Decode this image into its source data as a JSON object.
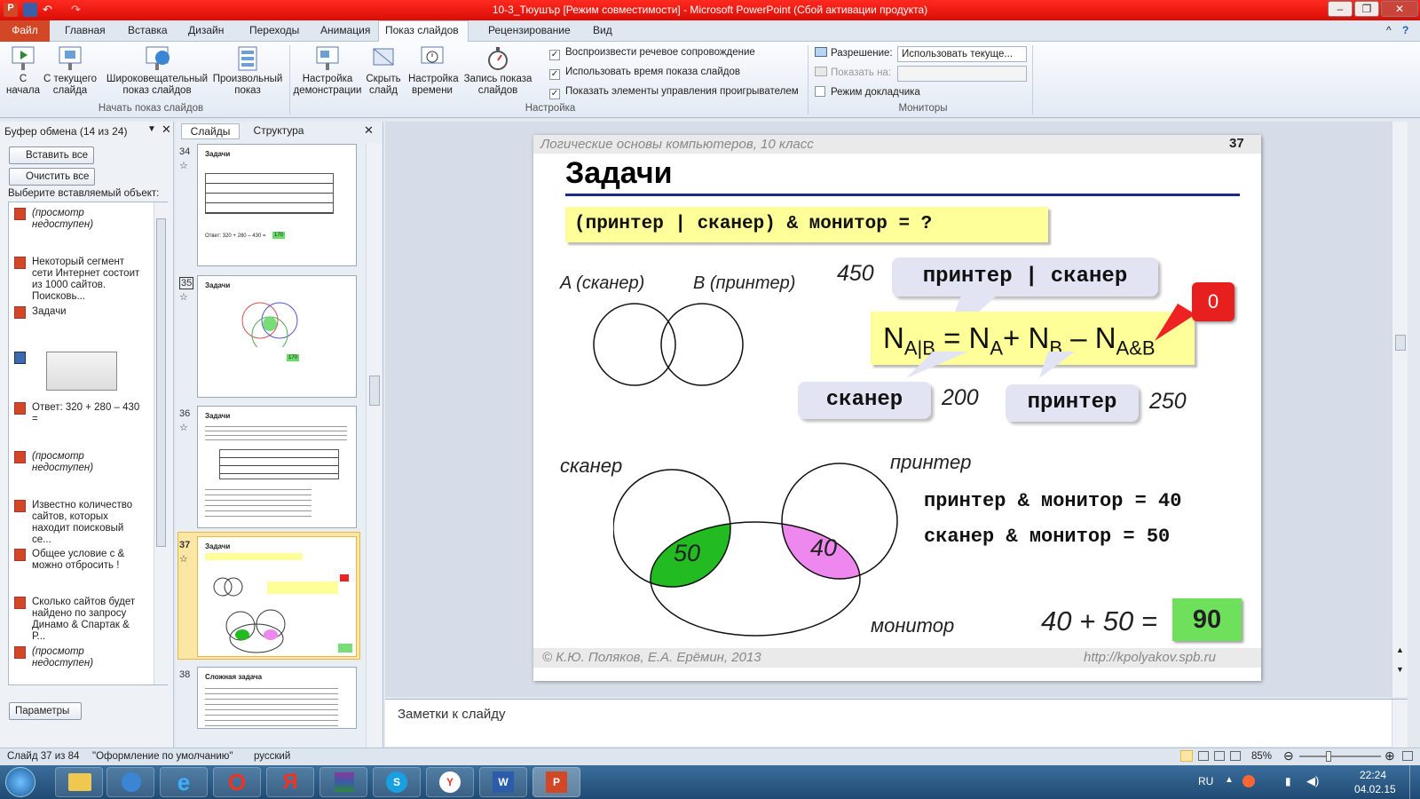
{
  "window": {
    "title": "10-3_Тюушър [Режим совместимости]  -  Microsoft PowerPoint (Сбой активации продукта)",
    "minimize": "–",
    "maximize": "❐",
    "close": "✕"
  },
  "tabs": {
    "file": "Файл",
    "items": [
      "Главная",
      "Вставка",
      "Дизайн",
      "Переходы",
      "Анимация",
      "Показ слайдов",
      "Рецензирование",
      "Вид"
    ],
    "help": "?"
  },
  "ribbon": {
    "group1": {
      "label": "Начать показ слайдов",
      "buttons": [
        "С начала",
        "С текущего слайда",
        "Широковещательный показ слайдов",
        "Произвольный показ"
      ]
    },
    "group2": {
      "label": "Настройка",
      "buttons": [
        "Настройка демонстрации",
        "Скрыть слайд",
        "Настройка времени",
        "Запись показа слайдов"
      ],
      "checks": [
        "Воспроизвести речевое сопровождение",
        "Использовать время показа слайдов",
        "Показать элементы управления проигрывателем"
      ]
    },
    "group3": {
      "label": "Мониторы",
      "resolution_label": "Разрешение:",
      "resolution_value": "Использовать текуще...",
      "show_on_label": "Показать на:",
      "presenter_mode": "Режим докладчика"
    }
  },
  "clipboard": {
    "header": "Буфер обмена (14 из 24)",
    "paste_all": "Вставить все",
    "clear_all": "Очистить все",
    "prompt": "Выберите вставляемый объект:",
    "items": [
      "(просмотр недоступен)",
      "Некоторый сегмент сети Интернет состоит из 1000 сайтов. Поисковь...",
      "Задачи",
      "",
      "Ответ: 320 + 280 – 430 =",
      "(просмотр недоступен)",
      "Известно количество сайтов, которых находит поисковый се...",
      "Общее условие с & можно отбросить !",
      "Сколько сайтов будет найдено по запросу Динамо & Спартак & Р...",
      "(просмотр недоступен)"
    ],
    "params": "Параметры"
  },
  "panel_tabs": {
    "slides": "Слайды",
    "outline": "Структура"
  },
  "thumbnails": [
    {
      "num": "34",
      "title": "Задачи",
      "answer": "Ответ: 320 + 280 – 430 =",
      "result": "170"
    },
    {
      "num": "35",
      "title": "Задачи",
      "result": "170"
    },
    {
      "num": "36",
      "title": "Задачи"
    },
    {
      "num": "37",
      "title": "Задачи"
    },
    {
      "num": "38",
      "title": "Сложная задача"
    }
  ],
  "slide": {
    "header": "Логические основы компьютеров, 10 класс",
    "number": "37",
    "title": "Задачи",
    "query": "(принтер | сканер) & монитор = ?",
    "label_a": "A (сканер)",
    "label_b": "B (принтер)",
    "n450": "450",
    "callout_or": "принтер | сканер",
    "formula": {
      "n": "N",
      "s1": "A|B",
      "eq": " = N",
      "s2": "A",
      "plus": "+ N",
      "s3": "B",
      "minus": " – N",
      "s4": "A&B"
    },
    "zero": "0",
    "callout_scanner": "сканер",
    "n200": "200",
    "callout_printer": "принтер",
    "n250": "250",
    "venn_scanner": "сканер",
    "venn_printer": "принтер",
    "venn_monitor": "монитор",
    "v50": "50",
    "v40": "40",
    "eq1": "принтер & монитор = 40",
    "eq2": "сканер & монитор = 50",
    "sum": "40 + 50 =",
    "result": "90",
    "footer_left": "© К.Ю. Поляков, Е.А. Ерёмин, 2013",
    "footer_right": "http://kpolyakov.spb.ru"
  },
  "notes_placeholder": "Заметки к слайду",
  "status": {
    "slide": "Слайд 37 из 84",
    "theme": "\"Оформление по умолчанию\"",
    "lang": "русский",
    "zoom": "85%"
  },
  "tray": {
    "lang": "RU",
    "time": "22:24",
    "date": "04.02.15"
  },
  "colors": {
    "title_red": "#e8221b",
    "file_tab": "#d24726",
    "highlight_yellow": "#ffff99",
    "green": "#66dd55",
    "pink": "#ee88ee",
    "callout_bg": "#e2e4f3"
  }
}
